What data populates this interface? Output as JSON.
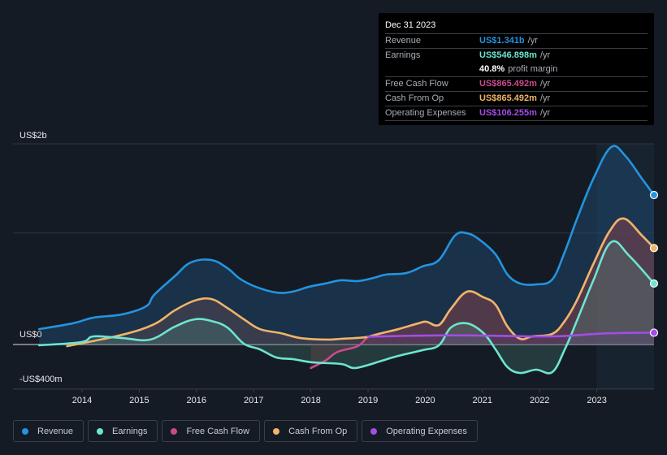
{
  "tooltip": {
    "date": "Dec 31 2023",
    "rows": [
      {
        "label": "Revenue",
        "value": "US$1.341b",
        "unit": "/yr",
        "color": "#2394df"
      },
      {
        "label": "Earnings",
        "value": "US$546.898m",
        "unit": "/yr",
        "color": "#6ce5d0"
      },
      {
        "label": "Free Cash Flow",
        "value": "US$865.492m",
        "unit": "/yr",
        "color": "#c84b8e"
      },
      {
        "label": "Cash From Op",
        "value": "US$865.492m",
        "unit": "/yr",
        "color": "#efb468"
      },
      {
        "label": "Operating Expenses",
        "value": "US$106.255m",
        "unit": "/yr",
        "color": "#a24de6"
      }
    ],
    "profit_margin": {
      "value": "40.8%",
      "label": "profit margin"
    }
  },
  "legend": [
    {
      "label": "Revenue",
      "color": "#2394df"
    },
    {
      "label": "Earnings",
      "color": "#6ce5d0"
    },
    {
      "label": "Free Cash Flow",
      "color": "#c84b8e"
    },
    {
      "label": "Cash From Op",
      "color": "#efb468"
    },
    {
      "label": "Operating Expenses",
      "color": "#a24de6"
    }
  ],
  "chart_data": {
    "type": "area",
    "title": "",
    "xlabel": "",
    "ylabel": "",
    "y_tick_labels": [
      "US$2b",
      "US$0",
      "-US$400m"
    ],
    "x_tick_labels": [
      "2014",
      "2015",
      "2016",
      "2017",
      "2018",
      "2019",
      "2020",
      "2021",
      "2022",
      "2023"
    ],
    "xlim": [
      2013.25,
      2024.0
    ],
    "ylim": [
      -400,
      1800
    ],
    "gridlines_m": [
      1800,
      1000,
      0
    ],
    "highlight_range": [
      2023.0,
      2024.0
    ],
    "units": "US$ millions (trailing 12 months)",
    "legend_position": "bottom",
    "series": [
      {
        "name": "Revenue",
        "color": "#2394df",
        "x": [
          2013.25,
          2013.84,
          2014.2,
          2014.7,
          2015.12,
          2015.26,
          2015.62,
          2015.9,
          2016.26,
          2016.54,
          2016.76,
          2017.04,
          2017.4,
          2017.68,
          2017.96,
          2018.25,
          2018.53,
          2018.82,
          2019.1,
          2019.31,
          2019.67,
          2019.95,
          2020.24,
          2020.52,
          2020.73,
          2020.95,
          2021.23,
          2021.44,
          2021.66,
          2021.94,
          2022.22,
          2022.44,
          2022.65,
          2022.94,
          2023.25,
          2023.5,
          2023.79,
          2024.0
        ],
        "values": [
          138,
          190,
          241,
          270,
          343,
          445,
          612,
          736,
          758,
          685,
          590,
          517,
          466,
          474,
          517,
          547,
          576,
          569,
          598,
          627,
          641,
          700,
          758,
          977,
          998,
          940,
          809,
          627,
          547,
          539,
          583,
          831,
          1122,
          1487,
          1771,
          1691,
          1487,
          1341
        ]
      },
      {
        "name": "Earnings",
        "color": "#6ce5d0",
        "x": [
          2013.25,
          2013.99,
          2014.2,
          2014.7,
          2015.19,
          2015.62,
          2015.97,
          2016.26,
          2016.54,
          2016.83,
          2017.11,
          2017.4,
          2017.68,
          2018.03,
          2018.53,
          2018.74,
          2018.96,
          2019.24,
          2019.53,
          2019.95,
          2020.24,
          2020.45,
          2020.73,
          2021.02,
          2021.23,
          2021.44,
          2021.66,
          2021.94,
          2022.22,
          2022.44,
          2022.65,
          2022.94,
          2023.25,
          2023.57,
          2024.0
        ],
        "values": [
          -7,
          22,
          73,
          58,
          44,
          160,
          226,
          211,
          153,
          7,
          -44,
          -117,
          -131,
          -160,
          -175,
          -211,
          -190,
          -146,
          -102,
          -51,
          -7,
          153,
          190,
          102,
          -44,
          -204,
          -255,
          -226,
          -248,
          -44,
          211,
          576,
          918,
          794,
          547
        ]
      },
      {
        "name": "Free Cash Flow",
        "color": "#c84b8e",
        "x": [
          2018.0,
          2018.25,
          2018.47,
          2018.82,
          2019.0,
          2019.24,
          2019.53,
          2019.88,
          2020.02,
          2020.24,
          2020.45,
          2020.73,
          2021.02,
          2021.23,
          2021.44,
          2021.66,
          2021.87,
          2022.22,
          2022.44,
          2022.65,
          2022.94,
          2023.22,
          2023.47,
          2023.79,
          2024.0
        ],
        "values": [
          -211,
          -146,
          -66,
          -15,
          66,
          102,
          138,
          190,
          204,
          175,
          321,
          474,
          423,
          357,
          160,
          51,
          73,
          95,
          211,
          394,
          722,
          1013,
          1130,
          977,
          865
        ]
      },
      {
        "name": "Cash From Op",
        "color": "#efb468",
        "x": [
          2013.74,
          2014.7,
          2015.26,
          2015.62,
          2015.97,
          2016.26,
          2016.54,
          2016.83,
          2017.11,
          2017.47,
          2017.82,
          2018.25,
          2018.53,
          2018.96,
          2019.24,
          2019.53,
          2019.88,
          2020.02,
          2020.24,
          2020.45,
          2020.73,
          2021.02,
          2021.23,
          2021.44,
          2021.66,
          2021.87,
          2022.22,
          2022.44,
          2022.65,
          2022.94,
          2023.22,
          2023.47,
          2023.79,
          2024.0
        ],
        "values": [
          -15,
          87,
          182,
          306,
          394,
          408,
          328,
          226,
          138,
          102,
          58,
          44,
          51,
          66,
          102,
          138,
          190,
          204,
          175,
          321,
          474,
          423,
          357,
          160,
          51,
          73,
          95,
          211,
          394,
          722,
          1013,
          1130,
          977,
          865
        ]
      },
      {
        "name": "Operating Expenses",
        "color": "#a24de6",
        "x": [
          2019.0,
          2019.5,
          2020.0,
          2020.5,
          2021.0,
          2021.5,
          2022.0,
          2022.5,
          2023.0,
          2023.5,
          2024.0
        ],
        "values": [
          70,
          76,
          80,
          82,
          80,
          76,
          72,
          78,
          96,
          104,
          106
        ]
      }
    ]
  }
}
